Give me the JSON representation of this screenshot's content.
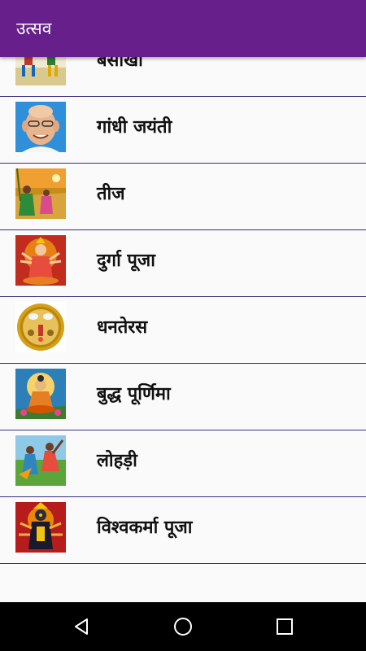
{
  "app_bar": {
    "title": "उत्सव",
    "color": "#661f8b"
  },
  "festivals": [
    {
      "label": "बसाखी",
      "icon": "baisakhi-thumbnail"
    },
    {
      "label": "गांधी जयंती",
      "icon": "gandhi-jayanti-thumbnail"
    },
    {
      "label": "तीज",
      "icon": "teej-thumbnail"
    },
    {
      "label": "दुर्गा पूजा",
      "icon": "durga-puja-thumbnail"
    },
    {
      "label": "धनतेरस",
      "icon": "dhanteras-thumbnail"
    },
    {
      "label": "बुद्ध पूर्णिमा",
      "icon": "buddha-purnima-thumbnail"
    },
    {
      "label": "लोहड़ी",
      "icon": "lohri-thumbnail"
    },
    {
      "label": "विश्वकर्मा पूजा",
      "icon": "vishwakarma-puja-thumbnail"
    }
  ],
  "nav_bar": {
    "back": "back-icon",
    "home": "home-icon",
    "recents": "recents-icon"
  }
}
